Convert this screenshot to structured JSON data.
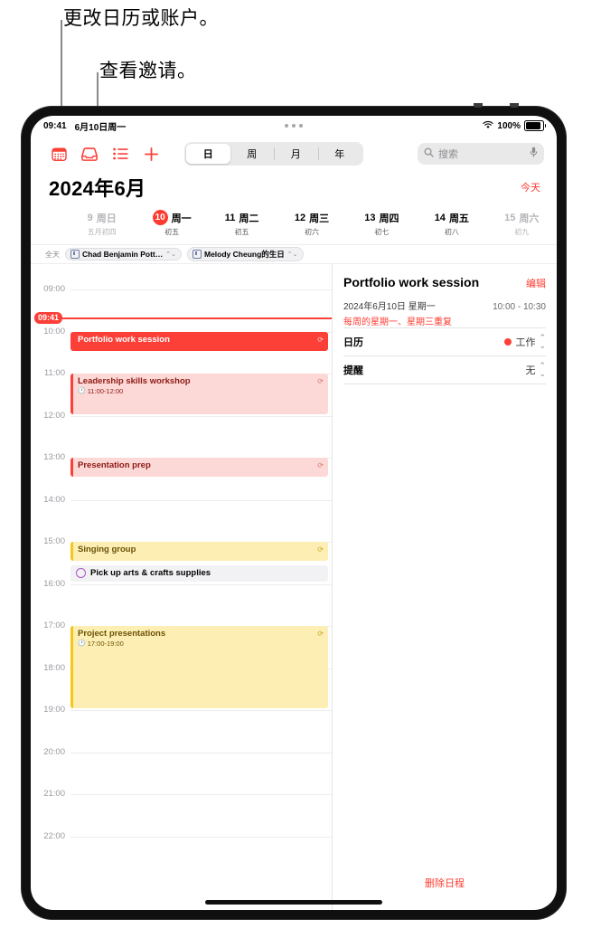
{
  "annotations": [
    {
      "text": "更改日历或账户。"
    },
    {
      "text": "查看邀请。"
    }
  ],
  "status_bar": {
    "time": "09:41",
    "date": "6月10日周一",
    "wifi_icon": "wifi-icon",
    "battery_percent": "100%"
  },
  "toolbar": {
    "calendars_icon": "calendar-icon",
    "inbox_icon": "inbox-icon",
    "list_icon": "list-icon",
    "add_icon": "plus-icon",
    "segments": [
      {
        "label": "日",
        "active": true
      },
      {
        "label": "周",
        "active": false
      },
      {
        "label": "月",
        "active": false
      },
      {
        "label": "年",
        "active": false
      }
    ],
    "search": {
      "icon": "search-icon",
      "placeholder": "搜索",
      "mic_icon": "microphone-icon"
    }
  },
  "header": {
    "month_title": "2024年6月",
    "today_button": "今天"
  },
  "days": [
    {
      "num": "9",
      "weekday": "周日",
      "lunar": "五月初四",
      "selected": false,
      "dim": true
    },
    {
      "num": "10",
      "weekday": "周一",
      "lunar": "初五",
      "selected": true,
      "dim": false
    },
    {
      "num": "11",
      "weekday": "周二",
      "lunar": "初五",
      "selected": false,
      "dim": false
    },
    {
      "num": "12",
      "weekday": "周三",
      "lunar": "初六",
      "selected": false,
      "dim": false
    },
    {
      "num": "13",
      "weekday": "周四",
      "lunar": "初七",
      "selected": false,
      "dim": false
    },
    {
      "num": "14",
      "weekday": "周五",
      "lunar": "初八",
      "selected": false,
      "dim": false
    },
    {
      "num": "15",
      "weekday": "周六",
      "lunar": "初九",
      "selected": false,
      "dim": true
    }
  ],
  "all_day": {
    "label": "全天",
    "invitations": [
      {
        "title": "Chad Benjamin Pott…"
      },
      {
        "title": "Melody Cheung的生日"
      }
    ]
  },
  "timeline": {
    "hours": [
      "09:00",
      "10:00",
      "11:00",
      "12:00",
      "13:00",
      "14:00",
      "15:00",
      "16:00",
      "17:00",
      "18:00",
      "19:00",
      "20:00",
      "21:00",
      "22:00"
    ],
    "now_indicator": "09:41",
    "events": [
      {
        "title": "Portfolio work session",
        "time": "",
        "style": "selected-red",
        "repeat_icon": "repeat-icon",
        "start_hour": 10.0,
        "end_hour": 10.5
      },
      {
        "title": "Leadership skills workshop",
        "time": "11:00-12:00",
        "style": "soft-red",
        "repeat_icon": "repeat-icon",
        "start_hour": 11.0,
        "end_hour": 12.0
      },
      {
        "title": "Presentation prep",
        "time": "",
        "style": "soft-red",
        "repeat_icon": "repeat-icon",
        "start_hour": 13.0,
        "end_hour": 13.5
      },
      {
        "title": "Singing group",
        "time": "",
        "style": "yellow",
        "repeat_icon": "repeat-icon",
        "start_hour": 15.0,
        "end_hour": 15.5
      },
      {
        "title": "Project presentations",
        "time": "17:00-19:00",
        "style": "yellow",
        "repeat_icon": "repeat-icon",
        "start_hour": 17.0,
        "end_hour": 19.0
      }
    ],
    "reminders": [
      {
        "title": "Pick up arts & crafts supplies",
        "circle_icon": "circle-icon",
        "start_hour": 15.55,
        "end_hour": 15.95
      }
    ]
  },
  "detail": {
    "title": "Portfolio work session",
    "edit_button": "编辑",
    "date": "2024年6月10日 星期一",
    "time": "10:00 - 10:30",
    "repeat": "每周的星期一、星期三重复",
    "rows": [
      {
        "label": "日历",
        "value": "工作",
        "has_dot": true,
        "dot_color": "#fc4038"
      },
      {
        "label": "提醒",
        "value": "无",
        "has_dot": false,
        "dot_color": ""
      }
    ],
    "delete_button": "删除日程"
  },
  "colors": {
    "accent_red": "#ff3b30",
    "event_red": "#fc4038",
    "event_red_soft": "#fcd8d6",
    "event_yellow": "#fdeeb4",
    "event_yellow_bar": "#f5c518",
    "reminder_purple": "#a855c8"
  }
}
